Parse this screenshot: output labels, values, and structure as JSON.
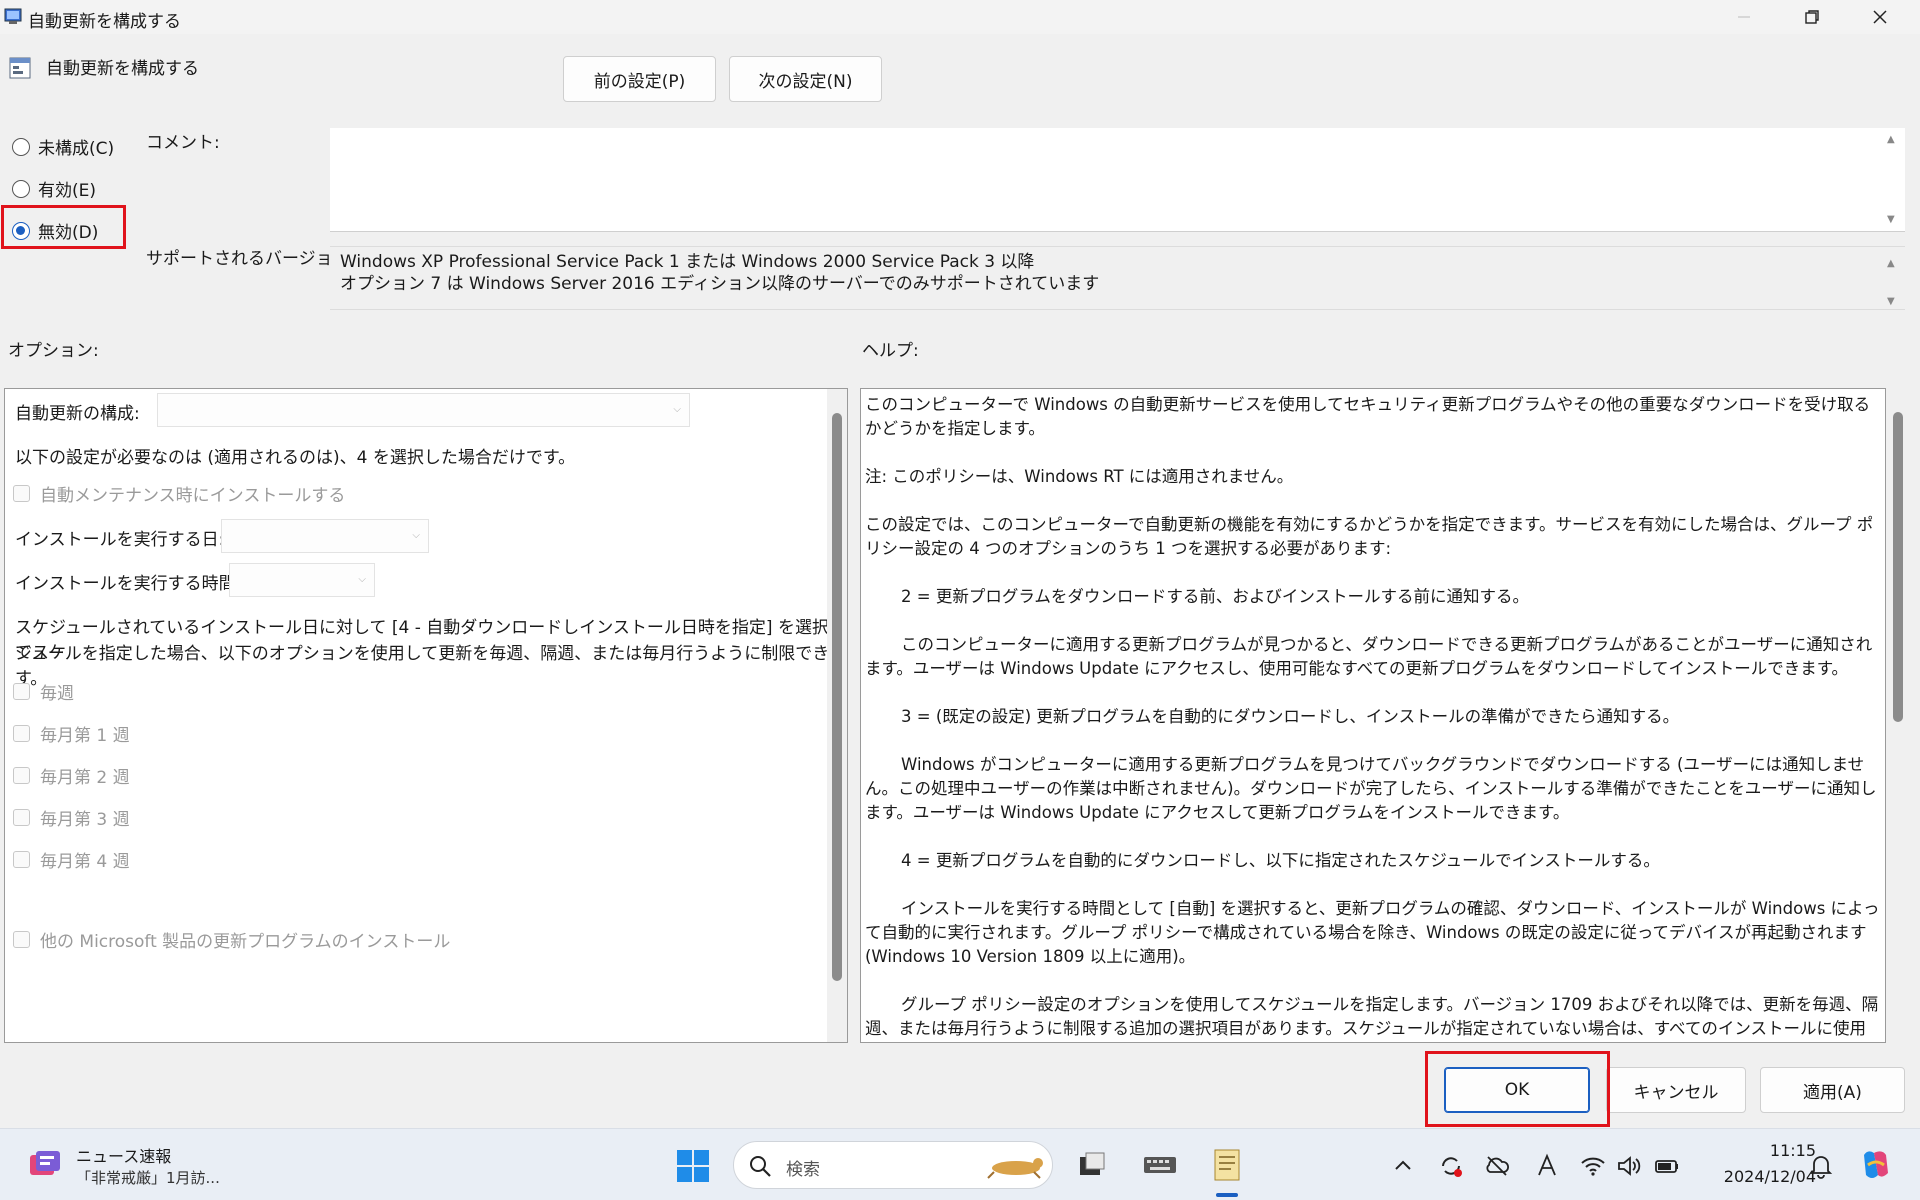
{
  "window": {
    "title": "自動更新を構成する",
    "policy_name": "自動更新を構成する"
  },
  "nav": {
    "prev_label": "前の設定(P)",
    "next_label": "次の設定(N)"
  },
  "state": {
    "options": [
      {
        "label": "未構成(C)",
        "checked": false
      },
      {
        "label": "有効(E)",
        "checked": false
      },
      {
        "label": "無効(D)",
        "checked": true
      }
    ]
  },
  "labels": {
    "comment": "コメント:",
    "supported": "サポートされるバージョン:",
    "options": "オプション:",
    "help": "ヘルプ:"
  },
  "supported_lines": [
    "Windows XP Professional Service Pack 1 または Windows 2000 Service Pack 3 以降",
    "オプション 7 は Windows Server 2016 エディション以降のサーバーでのみサポートされています"
  ],
  "options_pane": {
    "configure_label": "自動更新の構成:",
    "configure_value": "",
    "note": "以下の設定が必要なのは (適用されるのは)、4 を選択した場合だけです。",
    "maintenance": "自動メンテナンス時にインストールする",
    "day_label": "インストールを実行する日:",
    "time_label": "インストールを実行する時間:",
    "schedule_note_1": "スケジュールされているインストール日に対して [4 - 自動ダウンロードしインストール日時を指定] を選択してスケ",
    "schedule_note_2": "ジュールを指定した場合、以下のオプションを使用して更新を毎週、隔週、または毎月行うように制限できます。",
    "weekly": "毎週",
    "week1": "毎月第 1 週",
    "week2": "毎月第 2 週",
    "week3": "毎月第 3 週",
    "week4": "毎月第 4 週",
    "other_products": "他の Microsoft 製品の更新プログラムのインストール"
  },
  "help_paragraphs": [
    {
      "text": "このコンピューターで Windows の自動更新サービスを使用してセキュリティ更新プログラムやその他の重要なダウンロードを受け取るかどうかを指定します。",
      "indent": false
    },
    {
      "text": "注: このポリシーは、Windows RT には適用されません。",
      "indent": false
    },
    {
      "text": "この設定では、このコンピューターで自動更新の機能を有効にするかどうかを指定できます。サービスを有効にした場合は、グループ ポリシー設定の 4 つのオプションのうち 1 つを選択する必要があります:",
      "indent": false
    },
    {
      "text": "2 = 更新プログラムをダウンロードする前、およびインストールする前に通知する。",
      "indent": true
    },
    {
      "text": "このコンピューターに適用する更新プログラムが見つかると、ダウンロードできる更新プログラムがあることがユーザーに通知されます。ユーザーは Windows Update にアクセスし、使用可能なすべての更新プログラムをダウンロードしてインストールできます。",
      "indent": true
    },
    {
      "text": "3 = (既定の設定) 更新プログラムを自動的にダウンロードし、インストールの準備ができたら通知する。",
      "indent": true
    },
    {
      "text": "Windows がコンピューターに適用する更新プログラムを見つけてバックグラウンドでダウンロードする (ユーザーには通知しません。この処理中ユーザーの作業は中断されません)。ダウンロードが完了したら、インストールする準備ができたことをユーザーに通知します。ユーザーは Windows Update にアクセスして更新プログラムをインストールできます。",
      "indent": true
    },
    {
      "text": "4 = 更新プログラムを自動的にダウンロードし、以下に指定されたスケジュールでインストールする。",
      "indent": true
    },
    {
      "text": "インストールを実行する時間として [自動] を選択すると、更新プログラムの確認、ダウンロード、インストールが Windows によって自動的に実行されます。グループ ポリシーで構成されている場合を除き、Windows の既定の設定に従ってデバイスが再起動されます (Windows 10 Version 1809 以上に適用)。",
      "indent": true
    },
    {
      "text": "グループ ポリシー設定のオプションを使用してスケジュールを指定します。バージョン 1709 およびそれ以降では、更新を毎週、隔週、または毎月行うように制限する追加の選択項目があります。スケジュールが指定されていない場合は、すべてのインストールに使用される既定のスケジュールは、毎",
      "indent": true
    }
  ],
  "footer": {
    "ok_label": "OK",
    "cancel_label": "キャンセル",
    "apply_label": "適用(A)"
  },
  "taskbar": {
    "news_title": "ニュース速報",
    "news_sub": "「非常戒厳」1月訪...",
    "search_placeholder": "検索",
    "time": "11:15",
    "date": "2024/12/04"
  },
  "colors": {
    "accent": "#1b5fc1",
    "highlight": "#e0131b"
  }
}
